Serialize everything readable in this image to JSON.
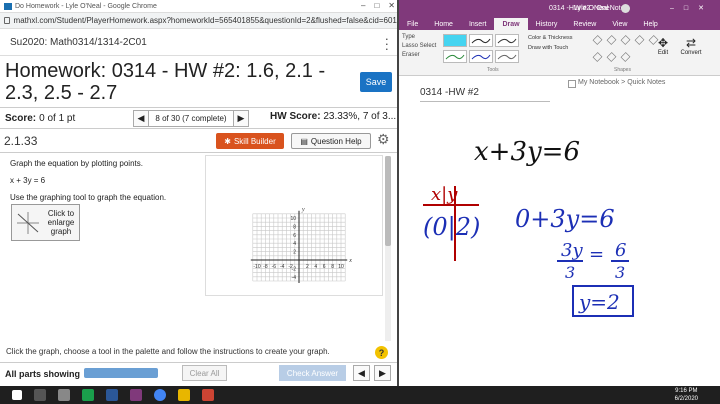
{
  "browser": {
    "window_title": "Do Homework - Lyle O'Neal - Google Chrome",
    "url": "mathxl.com/Student/PlayerHomework.aspx?homeworkId=565401855&questionId=2&flushed=false&cid=6010426&center..."
  },
  "course": "Su2020: Math0314/1314-2C01",
  "homework": {
    "title": "Homework: 0314 - HW #2: 1.6, 2.1 - 2.3, 2.5 - 2.7",
    "save": "Save",
    "score_label": "Score:",
    "score_value": "0 of 1 pt",
    "nav_label": "8 of 30 (7 complete)",
    "hw_score_label": "HW Score:",
    "hw_score_value": "23.33%, 7 of 3...",
    "question_number": "2.1.33",
    "skill_builder": "Skill Builder",
    "question_help": "Question Help",
    "instruction1": "Graph the equation by plotting points.",
    "equation": "x + 3y = 6",
    "instruction2": "Use the graphing tool to graph the equation.",
    "enlarge_label": "Click to enlarge graph",
    "footer_instruction": "Click the graph, choose a tool in the palette and follow the instructions to create your graph.",
    "help_symbol": "?",
    "parts_label": "All parts showing",
    "clear_all": "Clear All",
    "check_answer": "Check Answer"
  },
  "graph": {
    "x_ticks": [
      "-10",
      "-8",
      "-6",
      "-4",
      "-2",
      "2",
      "4",
      "6",
      "8",
      "10"
    ],
    "y_ticks": [
      "10",
      "8",
      "6",
      "4",
      "2",
      "-2",
      "-4"
    ],
    "x_label": "x",
    "y_label": "y"
  },
  "onenote": {
    "window_title": "0314 -HW #2 - OneNote",
    "user": "Lyle ONeal",
    "tabs": [
      "File",
      "Home",
      "Insert",
      "Draw",
      "History",
      "Review",
      "View",
      "Help"
    ],
    "tools": [
      "Type",
      "Lasso Select",
      "Eraser"
    ],
    "color_thickness": "Color & Thickness",
    "draw_with_touch": "Draw with Touch",
    "tools_group": "Tools",
    "shapes_group": "Shapes",
    "edit": "Edit",
    "convert": "Convert",
    "notebook_path": "My Notebook > Quick Notes",
    "page_title": "0314 -HW #2"
  },
  "handwriting": {
    "equation": "x+3y=6",
    "table_header": "x|y",
    "table_row": "(0|2)",
    "step1": "0+3y=6",
    "step2_left": "3y",
    "step2_left_den": "3",
    "step2_right": "6",
    "step2_right_den": "3",
    "result": "y=2"
  },
  "taskbar": {
    "time": "9:16 PM",
    "date": "6/2/2020"
  },
  "colors": {
    "onenote_purple": "#80397b",
    "save_blue": "#1a73c4",
    "skill_orange": "#d9531e",
    "ink_black": "#111111",
    "ink_blue": "#1c2fb5",
    "ink_red": "#b00000"
  }
}
